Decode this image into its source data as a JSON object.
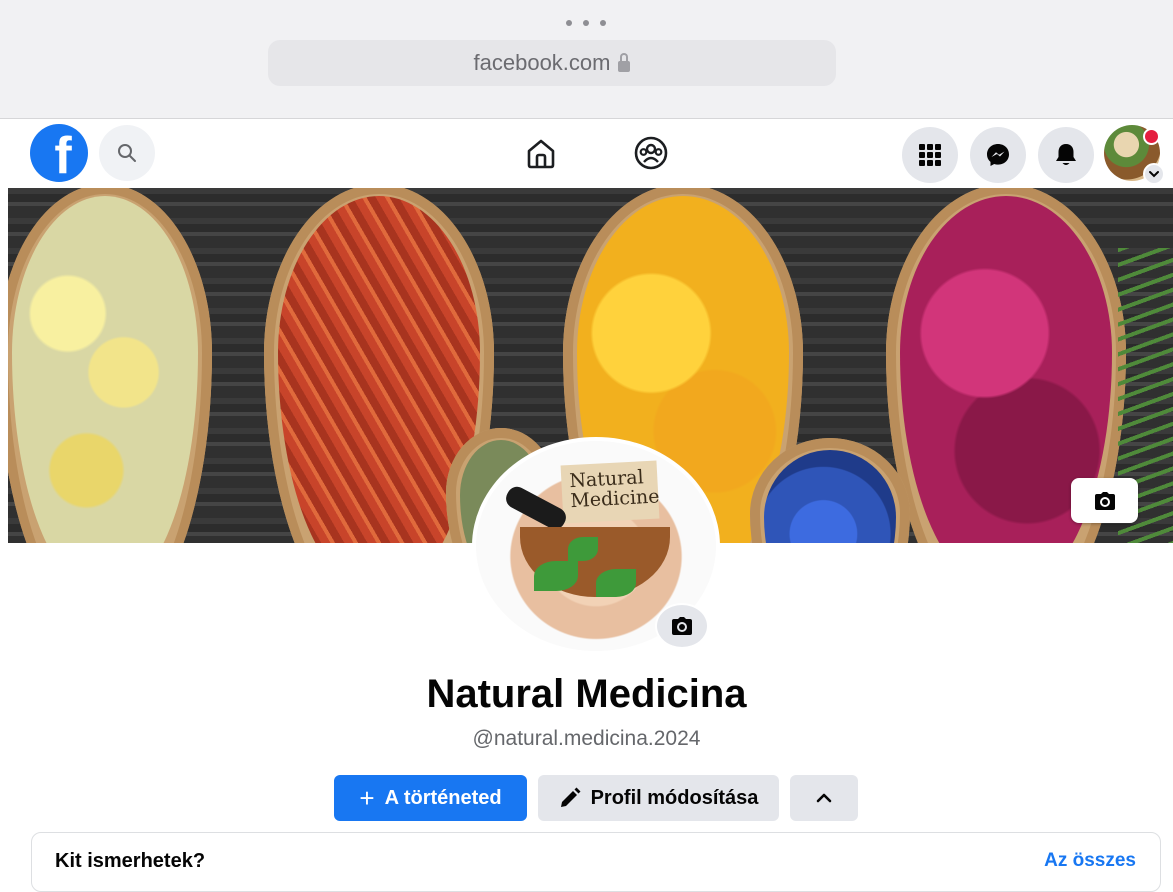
{
  "browser": {
    "url": "facebook.com"
  },
  "nav": {
    "logo_letter": "f",
    "icons": [
      "facebook-logo",
      "search-icon",
      "home-icon",
      "groups-icon",
      "menu-grid-icon",
      "messenger-icon",
      "notifications-bell-icon",
      "account-avatar"
    ]
  },
  "cover": {
    "colors": [
      "#f2e48a",
      "#c8442a",
      "#f2b01e",
      "#a8205a",
      "#2f55b8"
    ]
  },
  "profile": {
    "picture_text_line1": "Natural",
    "picture_text_line2": "Medicine",
    "name": "Natural Medicina",
    "handle": "@natural.medicina.2024"
  },
  "actions": {
    "story_plus": "+",
    "story_label": "A történeted",
    "edit_label": "Profil módosítása"
  },
  "people_you_may_know": {
    "title": "Kit ismerhetek?",
    "see_all": "Az összes"
  },
  "colors": {
    "brand_blue": "#1877f2",
    "button_gray": "#e4e6eb",
    "text_primary": "#050505",
    "text_secondary": "#65676b"
  }
}
